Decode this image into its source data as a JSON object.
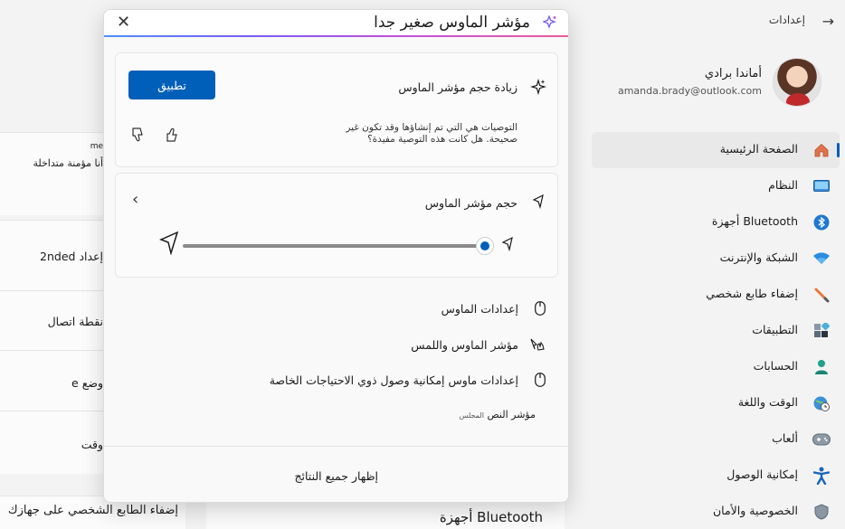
{
  "window": {
    "title": "إعدادات",
    "back_icon": "back-arrow-icon"
  },
  "profile": {
    "name": "أماندا برادي",
    "email": "amanda.brady@outlook.com"
  },
  "nav": {
    "items": [
      {
        "label": "الصفحة الرئيسية",
        "icon": "home-icon",
        "active": true
      },
      {
        "label": "النظام",
        "icon": "system-icon"
      },
      {
        "label": "أجهزة Bluetooth",
        "icon": "bluetooth-icon"
      },
      {
        "label": "الشبكة والإنترنت",
        "icon": "wifi-icon"
      },
      {
        "label": "إضفاء طابع شخصي",
        "icon": "brush-icon"
      },
      {
        "label": "التطبيقات",
        "icon": "apps-icon"
      },
      {
        "label": "الحسابات",
        "icon": "person-icon"
      },
      {
        "label": "الوقت واللغة",
        "icon": "globe-clock-icon"
      },
      {
        "label": "ألعاب",
        "icon": "gamepad-icon"
      },
      {
        "label": "إمكانية الوصول",
        "icon": "accessibility-icon"
      },
      {
        "label": "الخصوصية والأمان",
        "icon": "shield-icon"
      }
    ]
  },
  "content": {
    "cards": [
      {
        "line1": "me",
        "line2": "أنا مؤمنة متداخلة"
      },
      {
        "line1": "إعداد 2nded"
      },
      {
        "line1": "نقطة اتصال"
      },
      {
        "line1": "وضع e"
      },
      {
        "line1": "وقت"
      }
    ],
    "personalize_card": "إضفاء الطابع الشخصي على جهازك",
    "bluetooth_card": "أجهزة Bluetooth"
  },
  "search": {
    "value": "مؤشر الماوس صغير جدا",
    "close_icon": "close-icon"
  },
  "recommendation": {
    "title": "زيادة حجم مؤشر الماوس",
    "apply_label": "تطبيق",
    "disclaimer": "التوصيات هي التي تم إنشاؤها وقد تكون غير صحيحة. هل كانت هذه التوصية مفيدة؟"
  },
  "pointer_size": {
    "title": "حجم مؤشر الماوس",
    "value_fraction": 1.0
  },
  "results": [
    {
      "label": "إعدادات الماوس",
      "icon": "mouse-icon"
    },
    {
      "label": "مؤشر الماوس واللمس",
      "icon": "pointer-touch-icon"
    },
    {
      "label": "إعدادات ماوس إمكانية وصول ذوي الاحتياجات الخاصة",
      "icon": "mouse-icon"
    }
  ],
  "text_cursor": {
    "label": "مؤشر النص",
    "caption": "المجلس"
  },
  "show_all_label": "إظهار جميع النتائج",
  "colors": {
    "accent": "#005fb8",
    "copilot_gradient": [
      "#4f8ff7",
      "#c451d6"
    ]
  }
}
